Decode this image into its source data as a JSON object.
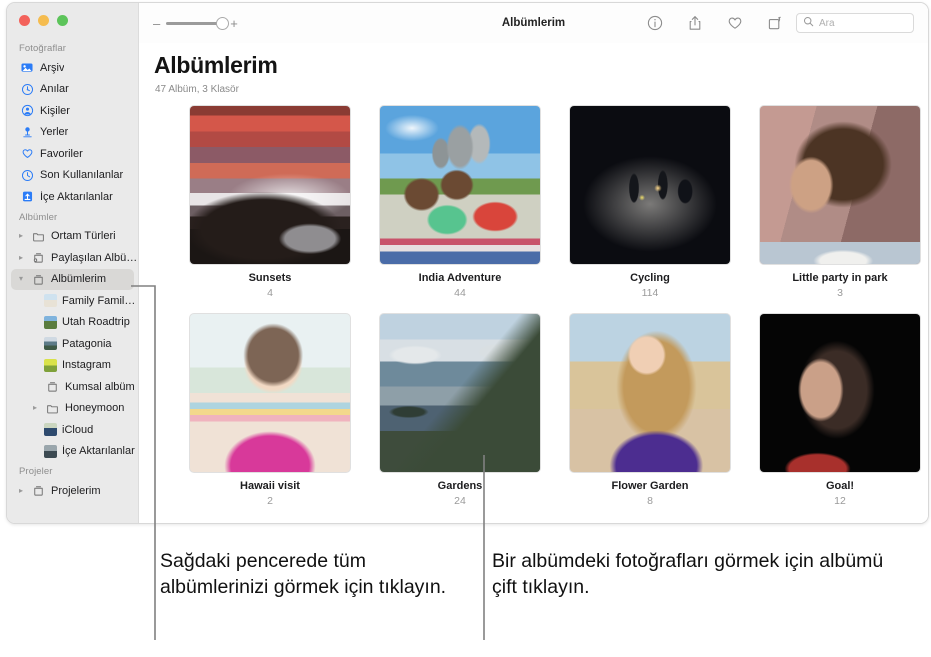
{
  "window": {
    "traffic_lights": [
      "close",
      "minimize",
      "zoom"
    ]
  },
  "toolbar": {
    "zoom_out_label": "–",
    "zoom_in_label": "+",
    "title": "Albümlerim",
    "icons": [
      "info-icon",
      "share-icon",
      "heart-icon",
      "rotate-icon"
    ],
    "search_placeholder": "Ara",
    "search_value": ""
  },
  "sidebar": {
    "sections": [
      {
        "title": "Fotoğraflar",
        "items": [
          {
            "label": "Arşiv",
            "icon": "archive-icon",
            "twisty": "",
            "level": 0,
            "selected": false
          },
          {
            "label": "Anılar",
            "icon": "memories-icon",
            "twisty": "",
            "level": 0,
            "selected": false
          },
          {
            "label": "Kişiler",
            "icon": "people-icon",
            "twisty": "",
            "level": 0,
            "selected": false
          },
          {
            "label": "Yerler",
            "icon": "places-pin-icon",
            "twisty": "",
            "level": 0,
            "selected": false
          },
          {
            "label": "Favoriler",
            "icon": "heart-icon",
            "twisty": "",
            "level": 0,
            "selected": false
          },
          {
            "label": "Son Kullanılanlar",
            "icon": "clock-icon",
            "twisty": "",
            "level": 0,
            "selected": false
          },
          {
            "label": "İçe Aktarılanlar",
            "icon": "import-icon",
            "twisty": "",
            "level": 0,
            "selected": false
          }
        ]
      },
      {
        "title": "Albümler",
        "items": [
          {
            "label": "Ortam Türleri",
            "icon": "folder-icon",
            "twisty": "collapsed",
            "level": 0,
            "selected": false
          },
          {
            "label": "Paylaşılan Albümler",
            "icon": "shared-album-icon",
            "twisty": "collapsed",
            "level": 0,
            "selected": false
          },
          {
            "label": "Albümlerim",
            "icon": "album-icon",
            "twisty": "expanded",
            "level": 0,
            "selected": true
          },
          {
            "label": "Family Family...",
            "icon": "photo-thumb-boat",
            "twisty": "",
            "level": 1,
            "selected": false
          },
          {
            "label": "Utah Roadtrip",
            "icon": "photo-thumb-utah",
            "twisty": "",
            "level": 1,
            "selected": false
          },
          {
            "label": "Patagonia",
            "icon": "photo-thumb-patagonia",
            "twisty": "",
            "level": 1,
            "selected": false
          },
          {
            "label": "Instagram",
            "icon": "photo-thumb-instagram",
            "twisty": "",
            "level": 1,
            "selected": false
          },
          {
            "label": "Kumsal albüm",
            "icon": "album-icon",
            "twisty": "",
            "level": 1,
            "selected": false
          },
          {
            "label": "Honeymoon",
            "icon": "folder-icon",
            "twisty": "collapsed",
            "level": 1,
            "selected": false
          },
          {
            "label": "iCloud",
            "icon": "photo-thumb-icloud",
            "twisty": "",
            "level": 1,
            "selected": false
          },
          {
            "label": "İçe Aktarılanlar",
            "icon": "photo-thumb-imported",
            "twisty": "",
            "level": 1,
            "selected": false
          }
        ]
      },
      {
        "title": "Projeler",
        "items": [
          {
            "label": "Projelerim",
            "icon": "album-icon",
            "twisty": "collapsed",
            "level": 0,
            "selected": false
          }
        ]
      }
    ]
  },
  "main": {
    "title": "Albümlerim",
    "subtitle": "47 Albüm, 3 Klasör",
    "albums": [
      {
        "name": "Sunsets",
        "count": "4",
        "art": "sunset"
      },
      {
        "name": "India Adventure",
        "count": "44",
        "art": "kids"
      },
      {
        "name": "Cycling",
        "count": "114",
        "art": "night"
      },
      {
        "name": "Little party in park",
        "count": "3",
        "art": "portrait1"
      },
      {
        "name": "Hawaii visit",
        "count": "2",
        "art": "girl"
      },
      {
        "name": "Gardens",
        "count": "24",
        "art": "mountains"
      },
      {
        "name": "Flower Garden",
        "count": "8",
        "art": "portrait2"
      },
      {
        "name": "Goal!",
        "count": "12",
        "art": "portrait3"
      }
    ]
  },
  "callouts": [
    {
      "text": "Sağdaki pencerede tüm albümlerinizi görmek için tıklayın."
    },
    {
      "text": "Bir albümdeki fotoğrafları görmek için albümü çift tıklayın."
    }
  ],
  "colors": {
    "accent": "#2b7cf7",
    "sidebar_bg": "#eaeaea",
    "selection_bg": "#d9d8d6",
    "callout_line": "#808080"
  }
}
